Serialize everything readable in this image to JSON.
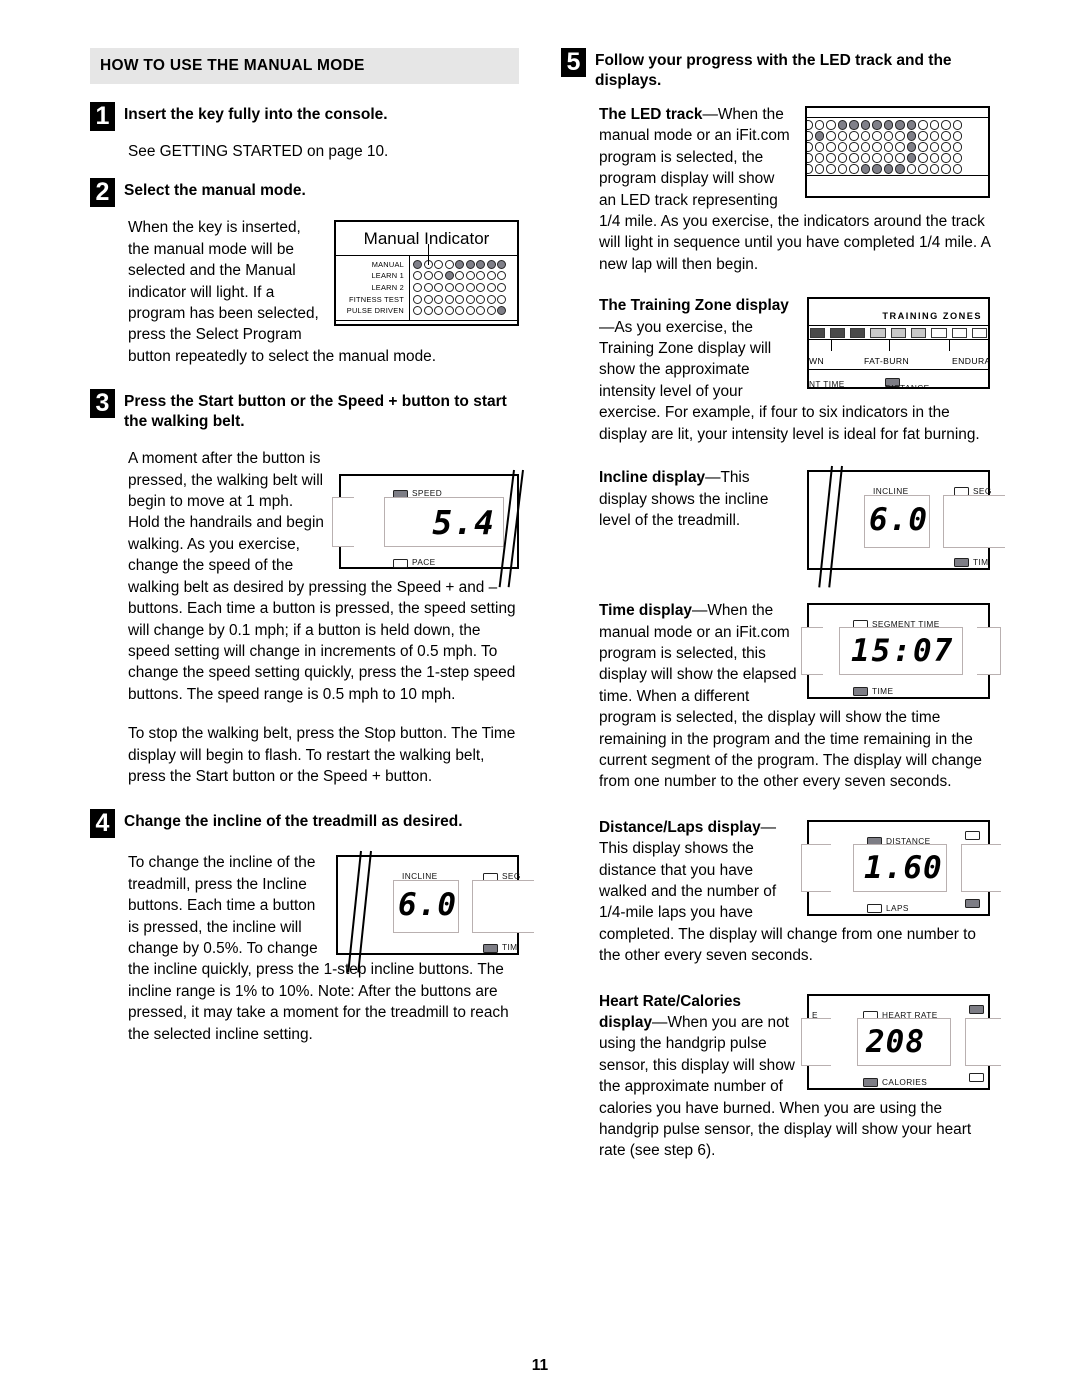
{
  "page_number": "11",
  "left_column": {
    "section_header": "HOW TO USE THE MANUAL MODE",
    "step1": {
      "num": "1",
      "title": "Insert the key fully into the console.",
      "body": "See GETTING STARTED on page 10."
    },
    "step2": {
      "num": "2",
      "title": "Select the manual mode.",
      "body_wrapped": "When the key is inserted, the manual mode will be selected and the Manual indicator will light. If a program has been selected, press the Select Program button repeatedly to select the manual mode."
    },
    "step3": {
      "num": "3",
      "title": "Press the Start button or the Speed + button to start the walking belt.",
      "para1": "A moment after the button is pressed, the walking belt will begin to move at 1 mph. Hold the handrails and begin walking. As you exercise, change the speed of the walking belt as desired by pressing the Speed + and – buttons. Each time a button is pressed, the speed setting will change by 0.1 mph; if a button is held down, the speed setting will change in increments of 0.5 mph. To change the speed setting quickly, press the 1-step speed buttons. The speed range is 0.5 mph to 10 mph.",
      "para2": "To stop the walking belt, press the Stop button. The Time display will begin to flash. To restart the walking belt, press the Start button or the Speed + button."
    },
    "step4": {
      "num": "4",
      "title": "Change the incline of the treadmill as desired.",
      "para1": "To change the incline of the treadmill, press the Incline buttons. Each time a button is pressed, the incline will change by 0.5%. To change the incline quickly, press the 1-step incline buttons. The incline range is 1% to 10%. Note: After the buttons are pressed, it may take a moment for the treadmill to reach the selected incline setting."
    },
    "manual_indicator_figure": {
      "caption": "Manual Indicator",
      "row_labels": [
        "MANUAL",
        "LEARN 1",
        "LEARN 2",
        "FITNESS TEST",
        "PULSE DRIVEN"
      ],
      "columns": 9,
      "lit_dots": [
        [
          true,
          false,
          false,
          false,
          true,
          true,
          true,
          true,
          true
        ],
        [
          false,
          false,
          false,
          true,
          false,
          false,
          false,
          false,
          false
        ],
        [
          false,
          false,
          false,
          false,
          false,
          false,
          false,
          false,
          false
        ],
        [
          false,
          false,
          false,
          false,
          false,
          false,
          false,
          false,
          false
        ],
        [
          false,
          false,
          false,
          false,
          false,
          false,
          false,
          false,
          true
        ]
      ]
    },
    "speed_figure": {
      "top_label": "SPEED",
      "top_lit": true,
      "value": "5.4",
      "bottom_label": "PACE",
      "bottom_lit": false
    },
    "incline_figure": {
      "label": "INCLINE",
      "value": "6.0",
      "right_top_label": "SEG",
      "right_top_lit": false,
      "right_bottom_label": "TIM",
      "right_bottom_lit": true
    }
  },
  "right_column": {
    "step5": {
      "num": "5",
      "title": "Follow your progress with the LED track and the displays."
    },
    "led_track": {
      "lead_bold": "The LED track",
      "dash": "—",
      "text": "When the manual mode or an iFit.com program is selected, the program display will show an LED track representing 1/4 mile. As you exercise, the indicators around the track will light in sequence until you have completed 1/4 mile. A new lap will then begin.",
      "figure": {
        "rows": 5,
        "columns": 14,
        "lit_dots": [
          [
            false,
            false,
            false,
            true,
            true,
            true,
            true,
            true,
            true,
            true,
            false,
            false,
            false,
            false
          ],
          [
            false,
            true,
            false,
            false,
            false,
            false,
            false,
            false,
            false,
            true,
            false,
            false,
            false,
            false
          ],
          [
            false,
            false,
            false,
            false,
            false,
            false,
            false,
            false,
            false,
            true,
            false,
            false,
            false,
            false
          ],
          [
            false,
            false,
            false,
            false,
            false,
            false,
            false,
            false,
            false,
            true,
            false,
            false,
            false,
            false
          ],
          [
            false,
            false,
            false,
            false,
            false,
            true,
            true,
            true,
            true,
            false,
            false,
            false,
            false,
            false
          ]
        ]
      }
    },
    "training_zone": {
      "lead_bold": "The Training Zone display",
      "dash": "—",
      "text": "As you exercise, the Training Zone display will show the approximate intensity level of your exercise. For example, if four to six indicators in the display are lit, your intensity level is ideal for fat burning.",
      "figure": {
        "title": "TRAINING ZONES",
        "zone_labels": [
          "WN",
          "FAT-BURN",
          "ENDURA"
        ],
        "segments": [
          "dark",
          "dark",
          "dark",
          "mid",
          "mid",
          "mid",
          "light",
          "light",
          "light"
        ],
        "row2_left": "NT TIME",
        "row2_center": "DISTANCE",
        "row2_center_lit": true
      }
    },
    "incline_display": {
      "lead_bold": "Incline display",
      "dash": "—",
      "text": "This display shows the incline level of the treadmill.",
      "figure": {
        "label": "INCLINE",
        "value": "6.0",
        "right_top_label": "SEG",
        "right_top_lit": false,
        "right_bottom_label": "TIM",
        "right_bottom_lit": true
      }
    },
    "time_display": {
      "lead_bold": "Time display",
      "dash": "—",
      "text": "When the manual mode or an iFit.com program is selected, this display will show the elapsed time. When a different program is selected, the display will show the time remaining in the program and the time remaining in the current segment of the program. The display will change from one number to the other every seven seconds.",
      "figure": {
        "top_label": "SEGMENT TIME",
        "top_lit": false,
        "value": "15:07",
        "bottom_label": "TIME",
        "bottom_lit": true
      }
    },
    "distance_laps": {
      "lead_bold": "Distance/Laps display",
      "dash": "—",
      "text": "This display shows the distance that you have walked and the number of 1/4-mile laps you have completed. The display will change from one number to the other every seven seconds.",
      "figure": {
        "top_label": "DISTANCE",
        "top_lit": true,
        "value": "1.60",
        "bottom_label": "LAPS",
        "bottom_lit": false
      }
    },
    "heart_rate": {
      "lead_bold": "Heart Rate/Calories display",
      "dash": "—",
      "text": "When you are not using the handgrip pulse sensor, this display will show the approximate number of calories you have burned. When you are using the handgrip pulse sensor, the display will show your heart rate (see step 6).",
      "figure": {
        "edge_label": "E",
        "top_label": "HEART RATE",
        "top_lit": false,
        "value": "208",
        "bottom_label": "CALORIES",
        "bottom_lit": true
      }
    }
  },
  "colors": {
    "header_bg": "#e6e6e6",
    "led_on": "#808089",
    "ink": "#000000"
  }
}
